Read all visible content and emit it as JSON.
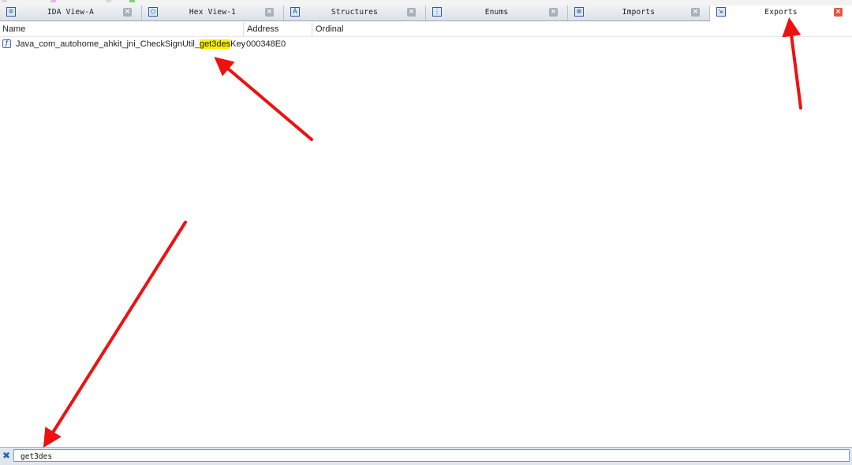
{
  "tabs": [
    {
      "label": "IDA View-A",
      "icon": "ida-view-icon",
      "glyph": "≡",
      "active": false
    },
    {
      "label": "Hex View-1",
      "icon": "hex-view-icon",
      "glyph": "◯",
      "active": false
    },
    {
      "label": "Structures",
      "icon": "structures-icon",
      "glyph": "A",
      "active": false
    },
    {
      "label": "Enums",
      "icon": "enums-icon",
      "glyph": "⋮",
      "active": false
    },
    {
      "label": "Imports",
      "icon": "imports-icon",
      "glyph": "⊞",
      "active": false
    },
    {
      "label": "Exports",
      "icon": "exports-icon",
      "glyph": "⇲",
      "active": true
    }
  ],
  "tab_close_glyph": "×",
  "columns": {
    "name": "Name",
    "address": "Address",
    "ordinal": "Ordinal"
  },
  "exports": [
    {
      "icon": "function-icon",
      "icon_glyph": "f",
      "name_before": "Java_com_autohome_ahkit_jni_CheckSignUtil_",
      "name_match": "get3des",
      "name_after": "Key",
      "address": "000348E0",
      "ordinal": ""
    }
  ],
  "filter": {
    "close_glyph": "✖",
    "value": "get3des"
  },
  "colors": {
    "highlight": "#f7f000",
    "arrow": "#ee1111",
    "active_close": "#e6573f"
  }
}
